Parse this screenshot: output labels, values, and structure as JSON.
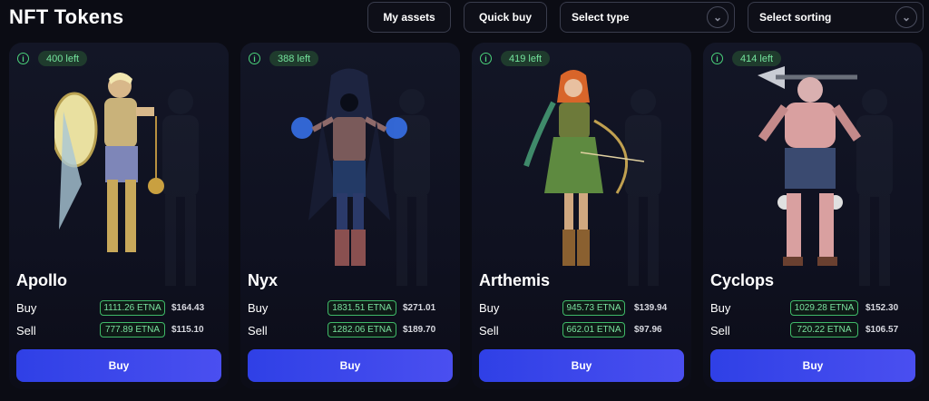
{
  "page": {
    "title": "NFT Tokens"
  },
  "toolbar": {
    "my_assets": "My assets",
    "quick_buy": "Quick buy",
    "select_type": "Select type",
    "select_sorting": "Select sorting"
  },
  "cards": [
    {
      "left": "400 left",
      "name": "Apollo",
      "buy_label": "Buy",
      "sell_label": "Sell",
      "buy_etna": "1111.26 ETNA",
      "buy_usd": "$164.43",
      "sell_etna": "777.89 ETNA",
      "sell_usd": "$115.10",
      "button": "Buy"
    },
    {
      "left": "388 left",
      "name": "Nyx",
      "buy_label": "Buy",
      "sell_label": "Sell",
      "buy_etna": "1831.51 ETNA",
      "buy_usd": "$271.01",
      "sell_etna": "1282.06 ETNA",
      "sell_usd": "$189.70",
      "button": "Buy"
    },
    {
      "left": "419 left",
      "name": "Arthemis",
      "buy_label": "Buy",
      "sell_label": "Sell",
      "buy_etna": "945.73 ETNA",
      "buy_usd": "$139.94",
      "sell_etna": "662.01 ETNA",
      "sell_usd": "$97.96",
      "button": "Buy"
    },
    {
      "left": "414 left",
      "name": "Cyclops",
      "buy_label": "Buy",
      "sell_label": "Sell",
      "buy_etna": "1029.28 ETNA",
      "buy_usd": "$152.30",
      "sell_etna": "720.22 ETNA",
      "sell_usd": "$106.57",
      "button": "Buy"
    }
  ],
  "colors": {
    "accent": "#3a48ec",
    "badge_green": "#4bd37b",
    "background": "#0b0c14"
  }
}
